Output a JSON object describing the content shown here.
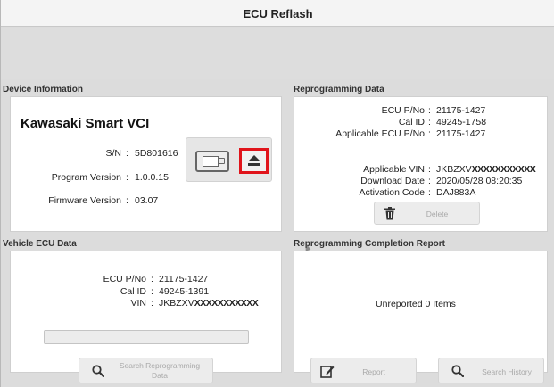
{
  "window": {
    "title": "ECU Reflash"
  },
  "device_info": {
    "section_label": "Device Information",
    "device_name": "Kawasaki Smart VCI",
    "rows": [
      {
        "label": "S/N",
        "value": "5D801616"
      },
      {
        "label": "Program Version",
        "value": "1.0.0.15"
      },
      {
        "label": "Firmware Version",
        "value": "03.07"
      }
    ],
    "icons": {
      "vci": "vci-device-icon",
      "eject": "eject-icon"
    },
    "highlight_color": "#e0141b"
  },
  "reprogramming_data": {
    "section_label": "Reprogramming Data",
    "rows_top": [
      {
        "label": "ECU P/No",
        "value": "21175-1427"
      },
      {
        "label": "Cal ID",
        "value": "49245-1758"
      },
      {
        "label": "Applicable ECU P/No",
        "value": "21175-1427"
      }
    ],
    "rows_bottom": [
      {
        "label": "Applicable VIN",
        "value_prefix": "JKBZXV",
        "value_masked": "XXXXXXXXXXX"
      },
      {
        "label": "Download Date",
        "value": "2020/05/28 08:20:35"
      },
      {
        "label": "Activation Code",
        "value": "DAJ883A"
      }
    ],
    "delete_button": {
      "label": "Delete",
      "icon": "trash-icon"
    }
  },
  "vehicle_ecu": {
    "section_label": "Vehicle ECU Data",
    "rows": [
      {
        "label": "ECU P/No",
        "value": "21175-1427"
      },
      {
        "label": "Cal ID",
        "value": "49245-1391"
      },
      {
        "label": "VIN",
        "value_prefix": "JKBZXV",
        "value_masked": "XXXXXXXXXXX"
      }
    ],
    "search_button": {
      "line1": "Search Reprogramming",
      "line2": "Data",
      "icon": "search-icon"
    }
  },
  "completion_report": {
    "section_label": "Reprogramming Completion Report",
    "status_text": "Unreported 0 Items",
    "report_button": {
      "label": "Report",
      "icon": "edit-icon"
    },
    "history_button": {
      "label": "Search History",
      "icon": "search-icon"
    }
  }
}
